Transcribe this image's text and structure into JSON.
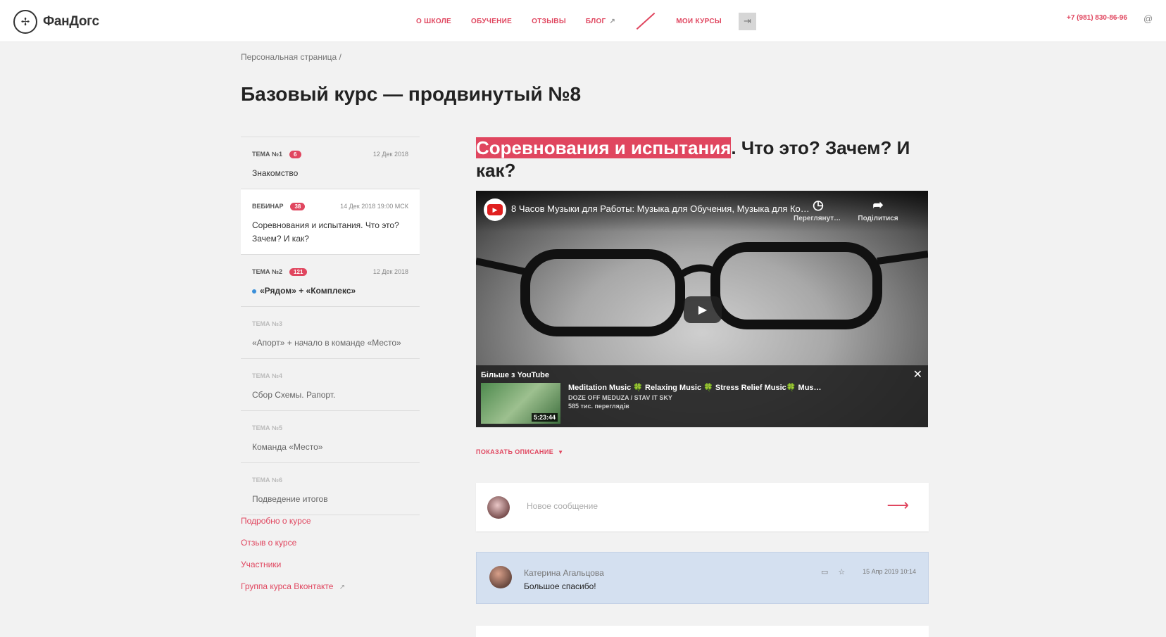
{
  "header": {
    "logo_text": "ФанДогс",
    "nav": [
      {
        "label": "О школе"
      },
      {
        "label": "Обучение"
      },
      {
        "label": "Отзывы"
      },
      {
        "label": "Блог"
      }
    ],
    "my_courses": "Мои курсы",
    "phone": "+7 (981) 830-86-96",
    "at_symbol": "@"
  },
  "breadcrumb": "Персональная страница  /",
  "page_title": "Базовый курс — продвинутый №8",
  "lessons": [
    {
      "tag": "Тема №1",
      "badge": "6",
      "date": "12 Дек 2018",
      "title": "Знакомство"
    },
    {
      "tag": "Вебинар",
      "badge": "38",
      "date": "14 Дек 2018 19:00 МСК",
      "title": "Соревнования и испытания. Что это? Зачем? И как?"
    },
    {
      "tag": "Тема №2",
      "badge": "121",
      "date": "12 Дек 2018",
      "title": "«Рядом» + «Комплекс»"
    },
    {
      "tag": "Тема №3",
      "title": "«Апорт» + начало в команде «Место»"
    },
    {
      "tag": "Тема №4",
      "title": "Сбор Схемы. Рапорт."
    },
    {
      "tag": "Тема №5",
      "title": "Команда «Место»"
    },
    {
      "tag": "Тема №6",
      "title": "Подведение итогов"
    }
  ],
  "side_links": [
    "Подробно о курсе",
    "Отзыв о курсе",
    "Участники",
    "Группа курса Вконтакте"
  ],
  "main": {
    "title_highlight": "Соревнования и испытания",
    "title_rest": ". Что это? Зачем? И как?",
    "video": {
      "title": "8 Часов Музыки для Работы: Музыка для Обучения, Музыка для Концентрации",
      "watch_later": "Переглянути пізніше",
      "share": "Поділитися",
      "more_label": "Більше з YouTube",
      "rec_title": "Meditation Music 🍀 Relaxing Music 🍀 Stress Relief Music🍀 Music for Sleep",
      "rec_channel": "DOZE OFF MEDUZA / STAV IT SKY",
      "rec_views": "585 тис. переглядів",
      "rec_duration": "5:23:44"
    },
    "show_description": "Показать описание",
    "composer_placeholder": "Новое сообщение",
    "comment": {
      "author": "Катерина Агальцова",
      "text": "Большое спасибо!",
      "date": "15 Апр 2019 10:14"
    }
  },
  "colors": {
    "accent": "#e0465f",
    "page_bg": "#f2f2f2",
    "comment_bg": "#d4e0f0"
  }
}
